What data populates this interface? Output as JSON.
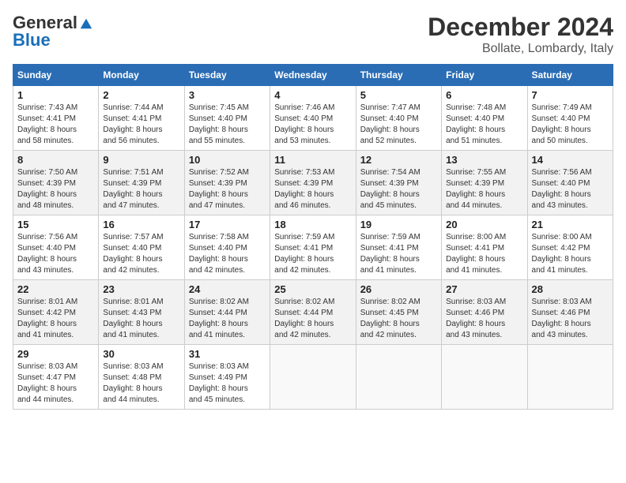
{
  "header": {
    "logo_general": "General",
    "logo_blue": "Blue",
    "month_title": "December 2024",
    "location": "Bollate, Lombardy, Italy"
  },
  "days_of_week": [
    "Sunday",
    "Monday",
    "Tuesday",
    "Wednesday",
    "Thursday",
    "Friday",
    "Saturday"
  ],
  "weeks": [
    [
      {
        "day": "1",
        "sunrise": "7:43 AM",
        "sunset": "4:41 PM",
        "daylight": "8 hours and 58 minutes."
      },
      {
        "day": "2",
        "sunrise": "7:44 AM",
        "sunset": "4:41 PM",
        "daylight": "8 hours and 56 minutes."
      },
      {
        "day": "3",
        "sunrise": "7:45 AM",
        "sunset": "4:40 PM",
        "daylight": "8 hours and 55 minutes."
      },
      {
        "day": "4",
        "sunrise": "7:46 AM",
        "sunset": "4:40 PM",
        "daylight": "8 hours and 53 minutes."
      },
      {
        "day": "5",
        "sunrise": "7:47 AM",
        "sunset": "4:40 PM",
        "daylight": "8 hours and 52 minutes."
      },
      {
        "day": "6",
        "sunrise": "7:48 AM",
        "sunset": "4:40 PM",
        "daylight": "8 hours and 51 minutes."
      },
      {
        "day": "7",
        "sunrise": "7:49 AM",
        "sunset": "4:40 PM",
        "daylight": "8 hours and 50 minutes."
      }
    ],
    [
      {
        "day": "8",
        "sunrise": "7:50 AM",
        "sunset": "4:39 PM",
        "daylight": "8 hours and 48 minutes."
      },
      {
        "day": "9",
        "sunrise": "7:51 AM",
        "sunset": "4:39 PM",
        "daylight": "8 hours and 47 minutes."
      },
      {
        "day": "10",
        "sunrise": "7:52 AM",
        "sunset": "4:39 PM",
        "daylight": "8 hours and 47 minutes."
      },
      {
        "day": "11",
        "sunrise": "7:53 AM",
        "sunset": "4:39 PM",
        "daylight": "8 hours and 46 minutes."
      },
      {
        "day": "12",
        "sunrise": "7:54 AM",
        "sunset": "4:39 PM",
        "daylight": "8 hours and 45 minutes."
      },
      {
        "day": "13",
        "sunrise": "7:55 AM",
        "sunset": "4:39 PM",
        "daylight": "8 hours and 44 minutes."
      },
      {
        "day": "14",
        "sunrise": "7:56 AM",
        "sunset": "4:40 PM",
        "daylight": "8 hours and 43 minutes."
      }
    ],
    [
      {
        "day": "15",
        "sunrise": "7:56 AM",
        "sunset": "4:40 PM",
        "daylight": "8 hours and 43 minutes."
      },
      {
        "day": "16",
        "sunrise": "7:57 AM",
        "sunset": "4:40 PM",
        "daylight": "8 hours and 42 minutes."
      },
      {
        "day": "17",
        "sunrise": "7:58 AM",
        "sunset": "4:40 PM",
        "daylight": "8 hours and 42 minutes."
      },
      {
        "day": "18",
        "sunrise": "7:59 AM",
        "sunset": "4:41 PM",
        "daylight": "8 hours and 42 minutes."
      },
      {
        "day": "19",
        "sunrise": "7:59 AM",
        "sunset": "4:41 PM",
        "daylight": "8 hours and 41 minutes."
      },
      {
        "day": "20",
        "sunrise": "8:00 AM",
        "sunset": "4:41 PM",
        "daylight": "8 hours and 41 minutes."
      },
      {
        "day": "21",
        "sunrise": "8:00 AM",
        "sunset": "4:42 PM",
        "daylight": "8 hours and 41 minutes."
      }
    ],
    [
      {
        "day": "22",
        "sunrise": "8:01 AM",
        "sunset": "4:42 PM",
        "daylight": "8 hours and 41 minutes."
      },
      {
        "day": "23",
        "sunrise": "8:01 AM",
        "sunset": "4:43 PM",
        "daylight": "8 hours and 41 minutes."
      },
      {
        "day": "24",
        "sunrise": "8:02 AM",
        "sunset": "4:44 PM",
        "daylight": "8 hours and 41 minutes."
      },
      {
        "day": "25",
        "sunrise": "8:02 AM",
        "sunset": "4:44 PM",
        "daylight": "8 hours and 42 minutes."
      },
      {
        "day": "26",
        "sunrise": "8:02 AM",
        "sunset": "4:45 PM",
        "daylight": "8 hours and 42 minutes."
      },
      {
        "day": "27",
        "sunrise": "8:03 AM",
        "sunset": "4:46 PM",
        "daylight": "8 hours and 43 minutes."
      },
      {
        "day": "28",
        "sunrise": "8:03 AM",
        "sunset": "4:46 PM",
        "daylight": "8 hours and 43 minutes."
      }
    ],
    [
      {
        "day": "29",
        "sunrise": "8:03 AM",
        "sunset": "4:47 PM",
        "daylight": "8 hours and 44 minutes."
      },
      {
        "day": "30",
        "sunrise": "8:03 AM",
        "sunset": "4:48 PM",
        "daylight": "8 hours and 44 minutes."
      },
      {
        "day": "31",
        "sunrise": "8:03 AM",
        "sunset": "4:49 PM",
        "daylight": "8 hours and 45 minutes."
      },
      null,
      null,
      null,
      null
    ]
  ]
}
